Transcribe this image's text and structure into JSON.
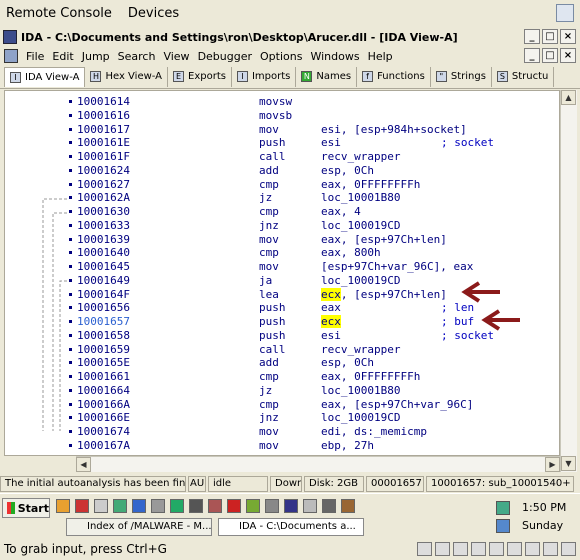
{
  "remote_console": {
    "menu": [
      "Remote Console",
      "Devices"
    ]
  },
  "ida": {
    "title": "IDA - C:\\Documents and Settings\\ron\\Desktop\\Arucer.dll - [IDA View-A]",
    "menu": [
      "File",
      "Edit",
      "Jump",
      "Search",
      "View",
      "Debugger",
      "Options",
      "Windows",
      "Help"
    ],
    "tabs": [
      {
        "label": "IDA View-A",
        "icon": "I",
        "active": true
      },
      {
        "label": "Hex View-A",
        "icon": "H"
      },
      {
        "label": "Exports",
        "icon": "E"
      },
      {
        "label": "Imports",
        "icon": "I"
      },
      {
        "label": "Names",
        "icon": "N"
      },
      {
        "label": "Functions",
        "icon": "f"
      },
      {
        "label": "Strings",
        "icon": "\""
      },
      {
        "label": "Structu",
        "icon": "S"
      }
    ],
    "lines": [
      {
        "addr": "10001614",
        "mnem": "movsw",
        "ops": "",
        "cmt": ""
      },
      {
        "addr": "10001616",
        "mnem": "movsb",
        "ops": "",
        "cmt": ""
      },
      {
        "addr": "10001617",
        "mnem": "mov",
        "ops": "esi, [esp+984h+socket]",
        "cmt": ""
      },
      {
        "addr": "1000161E",
        "mnem": "push",
        "ops": "esi",
        "cmt": "; socket"
      },
      {
        "addr": "1000161F",
        "mnem": "call",
        "ops": "recv_wrapper",
        "cmt": ""
      },
      {
        "addr": "10001624",
        "mnem": "add",
        "ops": "esp, 0Ch",
        "cmt": ""
      },
      {
        "addr": "10001627",
        "mnem": "cmp",
        "ops": "eax, 0FFFFFFFFh",
        "cmt": ""
      },
      {
        "addr": "1000162A",
        "mnem": "jz",
        "ops": "loc_10001B80",
        "cmt": ""
      },
      {
        "addr": "10001630",
        "mnem": "cmp",
        "ops": "eax, 4",
        "cmt": ""
      },
      {
        "addr": "10001633",
        "mnem": "jnz",
        "ops": "loc_100019CD",
        "cmt": ""
      },
      {
        "addr": "10001639",
        "mnem": "mov",
        "ops": "eax, [esp+97Ch+len]",
        "cmt": ""
      },
      {
        "addr": "10001640",
        "mnem": "cmp",
        "ops": "eax, 800h",
        "cmt": ""
      },
      {
        "addr": "10001645",
        "mnem": "mov",
        "ops": "[esp+97Ch+var_96C], eax",
        "cmt": ""
      },
      {
        "addr": "10001649",
        "mnem": "ja",
        "ops": "loc_100019CD",
        "cmt": ""
      },
      {
        "addr": "1000164F",
        "mnem": "lea",
        "ops": "ecx, [esp+97Ch+len]",
        "cmt": "",
        "hl": "ecx"
      },
      {
        "addr": "10001656",
        "mnem": "push",
        "ops": "eax",
        "cmt": "; len"
      },
      {
        "addr": "10001657",
        "mnem": "push",
        "ops": "ecx",
        "cmt": "; buf",
        "hl": "ecx",
        "current": true
      },
      {
        "addr": "10001658",
        "mnem": "push",
        "ops": "esi",
        "cmt": "; socket"
      },
      {
        "addr": "10001659",
        "mnem": "call",
        "ops": "recv_wrapper",
        "cmt": ""
      },
      {
        "addr": "1000165E",
        "mnem": "add",
        "ops": "esp, 0Ch",
        "cmt": ""
      },
      {
        "addr": "10001661",
        "mnem": "cmp",
        "ops": "eax, 0FFFFFFFFh",
        "cmt": ""
      },
      {
        "addr": "10001664",
        "mnem": "jz",
        "ops": "loc_10001B80",
        "cmt": ""
      },
      {
        "addr": "1000166A",
        "mnem": "cmp",
        "ops": "eax, [esp+97Ch+var_96C]",
        "cmt": ""
      },
      {
        "addr": "1000166E",
        "mnem": "jnz",
        "ops": "loc_100019CD",
        "cmt": ""
      },
      {
        "addr": "10001674",
        "mnem": "mov",
        "ops": "edi, ds:_memicmp",
        "cmt": ""
      },
      {
        "addr": "1000167A",
        "mnem": "mov",
        "ops": "ebp, 27h",
        "cmt": ""
      }
    ],
    "status": [
      "The initial autoanalysis has been finished.",
      "AU:",
      "idle",
      "Down",
      "Disk: 2GB",
      "00001657",
      "10001657: sub_10001540+"
    ]
  },
  "taskbar": {
    "start": "Start",
    "items": [
      {
        "label": "Index of /MALWARE - M..."
      },
      {
        "label": "IDA - C:\\Documents a...",
        "active": true
      }
    ],
    "time": "1:50 PM",
    "day": "Sunday"
  },
  "bottom": {
    "hint": "To grab input, press Ctrl+G"
  },
  "colors": {
    "text": "#000080",
    "comment": "#0000c0",
    "highlight": "#ffff00",
    "arrow": "#8b1a1a"
  }
}
